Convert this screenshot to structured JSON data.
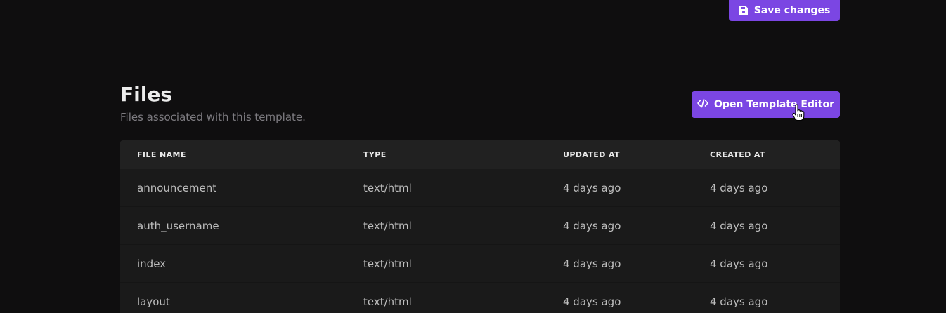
{
  "toolbar": {
    "save_label": "Save changes"
  },
  "files_section": {
    "title": "Files",
    "subtitle": "Files associated with this template.",
    "open_editor_label": "Open Template Editor"
  },
  "table": {
    "headers": [
      "FILE NAME",
      "TYPE",
      "UPDATED AT",
      "CREATED AT"
    ],
    "rows": [
      {
        "name": "announcement",
        "type": "text/html",
        "updated": "4 days ago",
        "created": "4 days ago"
      },
      {
        "name": "auth_username",
        "type": "text/html",
        "updated": "4 days ago",
        "created": "4 days ago"
      },
      {
        "name": "index",
        "type": "text/html",
        "updated": "4 days ago",
        "created": "4 days ago"
      },
      {
        "name": "layout",
        "type": "text/html",
        "updated": "4 days ago",
        "created": "4 days ago"
      }
    ]
  },
  "icons": {
    "save": "floppy-disk-icon",
    "code": "code-icon",
    "cursor": "hand-pointer-icon"
  },
  "colors": {
    "accent": "#7b46e3",
    "background": "#0f0e0f",
    "table_bg": "#1a1a1a",
    "table_header_bg": "#212121"
  }
}
